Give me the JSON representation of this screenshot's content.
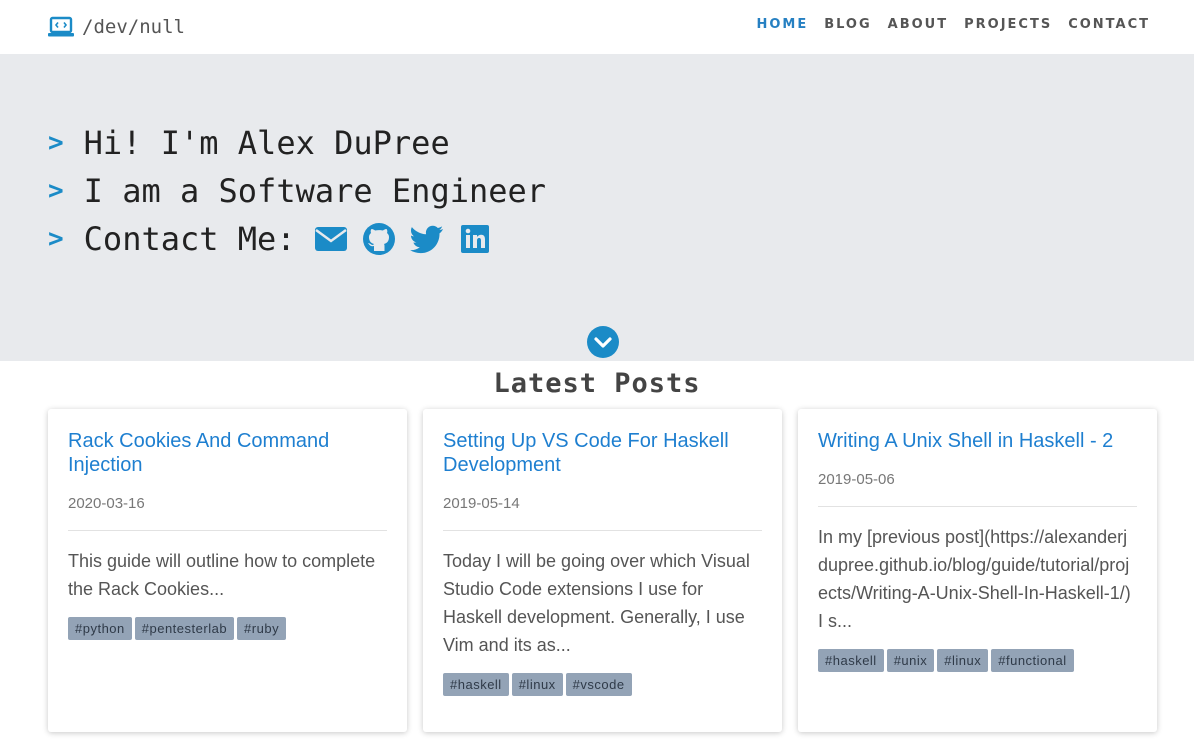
{
  "brand": {
    "text": "/dev/null",
    "icon": "laptop-code-icon"
  },
  "nav": {
    "items": [
      {
        "label": "HOME",
        "active": true
      },
      {
        "label": "BLOG",
        "active": false
      },
      {
        "label": "ABOUT",
        "active": false
      },
      {
        "label": "PROJECTS",
        "active": false
      },
      {
        "label": "CONTACT",
        "active": false
      }
    ]
  },
  "hero": {
    "prompt": ">",
    "line1": "Hi! I'm Alex DuPree",
    "line2": "I am a Software Engineer",
    "line3": "Contact Me:",
    "contact_icons": [
      "envelope-icon",
      "github-icon",
      "twitter-icon",
      "linkedin-icon"
    ]
  },
  "posts": {
    "title": "Latest Posts",
    "items": [
      {
        "title": "Rack Cookies And Command Injection",
        "date": "2020-03-16",
        "excerpt": "This guide will outline how to complete the Rack Cookies...",
        "tags": [
          "#python",
          "#pentesterlab",
          "#ruby"
        ]
      },
      {
        "title": "Setting Up VS Code For Haskell Development",
        "date": "2019-05-14",
        "excerpt": "Today I will be going over which Visual Studio Code extensions I use for Haskell development. Generally, I use Vim and its as...",
        "tags": [
          "#haskell",
          "#linux",
          "#vscode"
        ]
      },
      {
        "title": "Writing A Unix Shell in Haskell - 2",
        "date": "2019-05-06",
        "excerpt": "In my [previous post](https://alexanderjdupree.github.io/blog/guide/tutorial/projects/Writing-A-Unix-Shell-In-Haskell-1/) I s...",
        "tags": [
          "#haskell",
          "#unix",
          "#linux",
          "#functional"
        ]
      }
    ]
  },
  "colors": {
    "accent": "#1b8bc7",
    "link": "#1e7fd0",
    "hero_bg": "#e8eaed",
    "tag_bg": "#93a3b6"
  }
}
